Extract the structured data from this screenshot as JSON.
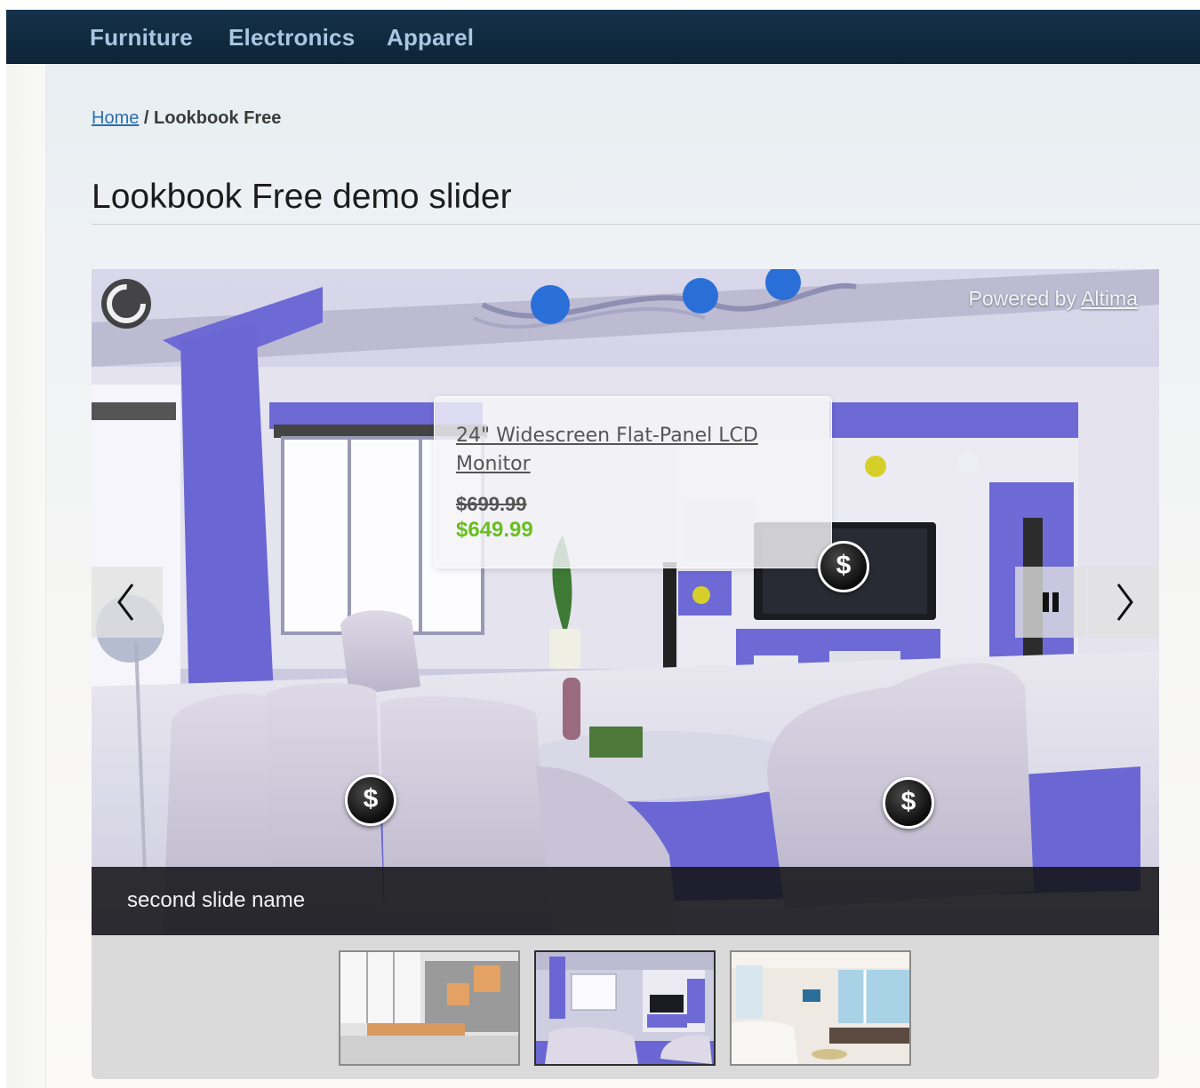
{
  "nav": {
    "items": [
      {
        "label": "Furniture"
      },
      {
        "label": "Electronics"
      },
      {
        "label": "Apparel"
      }
    ]
  },
  "breadcrumb": {
    "home": "Home",
    "separator": " / ",
    "current": "Lookbook Free"
  },
  "page": {
    "title": "Lookbook Free demo slider"
  },
  "slider": {
    "powered_prefix": "Powered by ",
    "powered_link": "Altima",
    "caption": "second slide name",
    "tooltip": {
      "product_name": "24\" Widescreen Flat-Panel LCD Monitor",
      "old_price": "$699.99",
      "new_price": "$649.99"
    },
    "hotspot_symbol": "$",
    "icons": {
      "prev": "chevron-left-icon",
      "next": "chevron-right-icon",
      "pause": "pause-icon",
      "loader": "loader-ring-icon"
    },
    "thumbnails": [
      {
        "name": "office interior",
        "active": false
      },
      {
        "name": "purple living room",
        "active": true
      },
      {
        "name": "sea view lounge",
        "active": false
      }
    ]
  },
  "colors": {
    "nav_bg": "#0e2336",
    "nav_text": "#a9c7e2",
    "link": "#2b6fb0",
    "accent_purple": "#6e6ad8",
    "price_new": "#6abf1e"
  }
}
